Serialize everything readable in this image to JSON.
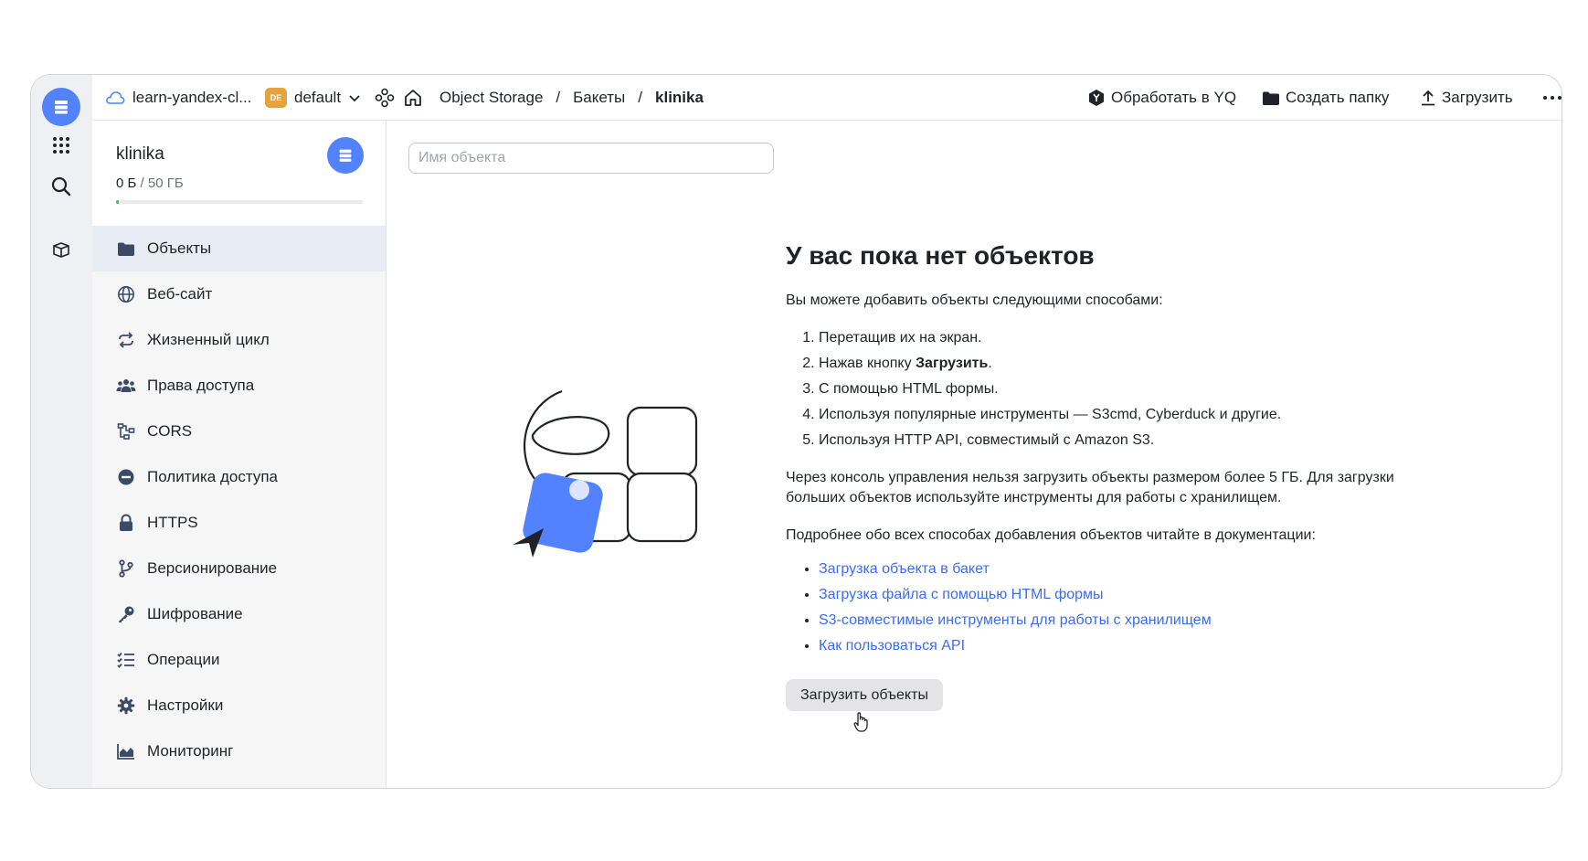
{
  "header": {
    "cloud_name": "learn-yandex-cl...",
    "folder_badge": "DE",
    "folder_name": "default",
    "breadcrumbs": [
      "Object Storage",
      "Бакеты",
      "klinika"
    ],
    "actions": {
      "process_yq": "Обработать в YQ",
      "create_folder": "Создать папку",
      "upload": "Загрузить"
    }
  },
  "bucket": {
    "name": "klinika",
    "size_used": "0 Б",
    "size_total": "50 ГБ",
    "usage_fraction": 0.01
  },
  "sidebar": {
    "items": [
      {
        "label": "Объекты",
        "icon": "folder-icon"
      },
      {
        "label": "Веб-сайт",
        "icon": "globe-icon"
      },
      {
        "label": "Жизненный цикл",
        "icon": "cycle-icon"
      },
      {
        "label": "Права доступа",
        "icon": "users-icon"
      },
      {
        "label": "CORS",
        "icon": "cors-icon"
      },
      {
        "label": "Политика доступа",
        "icon": "policy-icon"
      },
      {
        "label": "HTTPS",
        "icon": "lock-icon"
      },
      {
        "label": "Версионирование",
        "icon": "branch-icon"
      },
      {
        "label": "Шифрование",
        "icon": "key-icon"
      },
      {
        "label": "Операции",
        "icon": "list-icon"
      },
      {
        "label": "Настройки",
        "icon": "gear-icon"
      },
      {
        "label": "Мониторинг",
        "icon": "chart-icon"
      }
    ]
  },
  "search": {
    "placeholder": "Имя объекта"
  },
  "empty_state": {
    "title": "У вас пока нет объектов",
    "intro": "Вы можете добавить объекты следующими способами:",
    "ways": [
      "Перетащив их на экран.",
      "Нажав кнопку",
      "С помощью HTML формы.",
      "Используя популярные инструменты — S3cmd, Cyberduck и другие.",
      "Используя HTTP API, совместимый с Amazon S3."
    ],
    "ways_bold": "Загрузить",
    "ways_bold_suffix": ".",
    "note": "Через консоль управления нельзя загрузить объекты размером более 5 ГБ. Для загрузки больших объектов используйте инструменты для работы с хранилищем.",
    "docs_intro": "Подробнее обо всех способах добавления объектов читайте в документации:",
    "links": [
      "Загрузка объекта в бакет",
      "Загрузка файла с помощью HTML формы",
      "S3-совместимые инструменты для работы с хранилищем",
      "Как пользоваться API"
    ],
    "button": "Загрузить объекты"
  },
  "colors": {
    "accent": "#5282ff",
    "link": "#3a6df0",
    "badge": "#e6a23c",
    "progress": "#3bc15f"
  }
}
